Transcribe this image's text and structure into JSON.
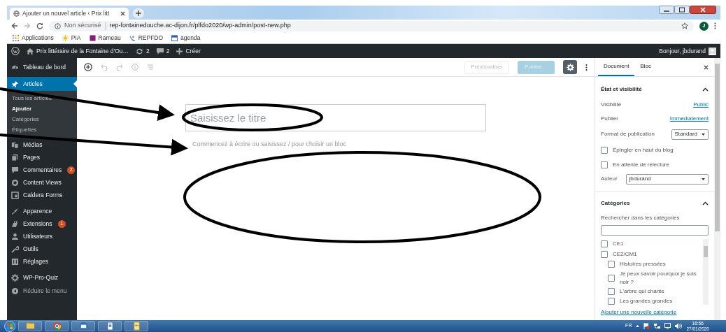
{
  "browser": {
    "tab_title": "Ajouter un nouvel article ‹ Prix litt",
    "security_label": "Non sécurisé",
    "url": "rep-fontainedouche.ac-dijon.fr/plfdo2020/wp-admin/post-new.php",
    "profile_initial": "J",
    "bookmarks": [
      {
        "label": "Applications"
      },
      {
        "label": "PIA"
      },
      {
        "label": "Rameau"
      },
      {
        "label": "REPFDO"
      },
      {
        "label": "agenda"
      }
    ]
  },
  "admin_bar": {
    "site_name": "Prix littéraire de la Fontaine d'Ou…",
    "updates": "2",
    "comments": "2",
    "new_label": "Créer",
    "greeting": "Bonjour, jbdurand"
  },
  "sidebar": {
    "groups": [
      [
        {
          "label": "Tableau de bord",
          "selected": false
        },
        {
          "label": "Articles",
          "selected": true,
          "children": [
            {
              "label": "Tous les articles",
              "selected": false
            },
            {
              "label": "Ajouter",
              "selected": true
            },
            {
              "label": "Catégories",
              "selected": false
            },
            {
              "label": "Étiquettes",
              "selected": false
            }
          ]
        },
        {
          "label": "Médias",
          "selected": false
        },
        {
          "label": "Pages",
          "selected": false
        },
        {
          "label": "Commentaires",
          "selected": false,
          "badge": "2"
        },
        {
          "label": "Content Views",
          "selected": false
        },
        {
          "label": "Caldera Forms",
          "selected": false
        }
      ],
      [
        {
          "label": "Apparence",
          "selected": false
        },
        {
          "label": "Extensions",
          "selected": false,
          "badge": "1"
        },
        {
          "label": "Utilisateurs",
          "selected": false
        },
        {
          "label": "Outils",
          "selected": false
        },
        {
          "label": "Réglages",
          "selected": false
        }
      ],
      [
        {
          "label": "WP-Pro-Quiz",
          "selected": false
        }
      ]
    ],
    "collapse_label": "Réduire le menu"
  },
  "editor": {
    "preview_button": {
      "label": "Prévisualiser",
      "disabled": true
    },
    "publish_button": {
      "label": "Publier…",
      "disabled": true
    },
    "title_placeholder": "Saisissez le titre",
    "body_placeholder": "Commencez à écrire ou saisissez / pour choisir un bloc"
  },
  "settings_panel": {
    "tabs": [
      {
        "label": "Document",
        "selected": true
      },
      {
        "label": "Bloc",
        "selected": false
      }
    ],
    "status_section": {
      "title": "État et visibilité",
      "expanded": true,
      "visibility_label": "Visibilité",
      "visibility_value": "Public",
      "publish_label": "Publier",
      "publish_value": "Immédiatement",
      "format_label": "Format de publication",
      "format_value": "Standard",
      "options": [
        {
          "label": "Épingler en haut du blog",
          "checked": false
        },
        {
          "label": "En attente de relecture",
          "checked": false
        }
      ],
      "author_label": "Auteur",
      "author_value": "jbdurand"
    },
    "categories_section": {
      "title": "Catégories",
      "expanded": true,
      "search_label": "Rechercher dans les catégories",
      "items": [
        {
          "label": "CE1",
          "checked": false
        },
        {
          "label": "CE2/CM1",
          "checked": false,
          "children": [
            {
              "label": "Histoires pressées",
              "checked": false
            },
            {
              "label": "Je peux savoir pourquoi je suis noir ?",
              "checked": false
            },
            {
              "label": "L'arbre qui chante",
              "checked": false
            },
            {
              "label": "Les grandes grandes",
              "checked": false
            }
          ]
        }
      ],
      "add_link": "Ajouter une nouvelle catégorie"
    }
  },
  "taskbar": {
    "language": "FR",
    "time": "16:56",
    "date": "27/01/2020"
  }
}
